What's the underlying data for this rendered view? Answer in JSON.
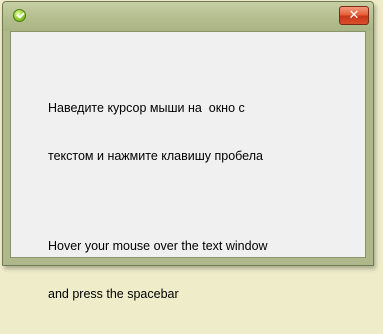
{
  "window": {
    "icon": "green-check-circle-icon",
    "close_glyph": "✕",
    "accent_color": "#aeb88a"
  },
  "content": {
    "instruction_ru_line1": "Наведите курсор мыши на  окно с",
    "instruction_ru_line2": "текстом и нажмите клавишу пробела",
    "instruction_en_line1": "Hover your mouse over the text window",
    "instruction_en_line2": "and press the spacebar"
  }
}
